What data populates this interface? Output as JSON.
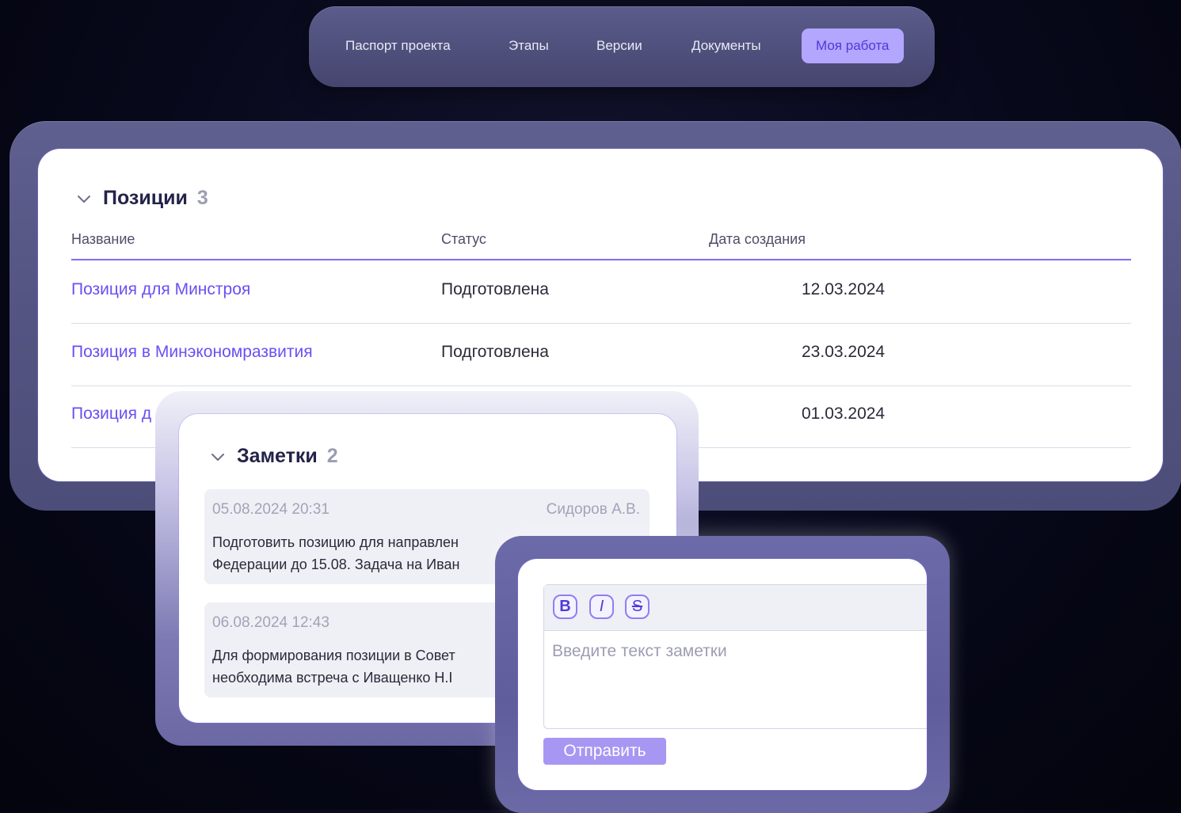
{
  "nav": {
    "items": [
      {
        "label": "Паспорт проекта"
      },
      {
        "label": "Этапы"
      },
      {
        "label": "Версии"
      },
      {
        "label": "Документы"
      },
      {
        "label": "Моя работа",
        "active": true
      }
    ]
  },
  "positions": {
    "title": "Позиции",
    "count": "3",
    "columns": [
      "Название",
      "Статус",
      "Дата создания"
    ],
    "rows": [
      {
        "name": "Позиция для Минстроя",
        "status": "Подготовлена",
        "date": "12.03.2024"
      },
      {
        "name": "Позиция в Минэкономразвития",
        "status": "Подготовлена",
        "date": "23.03.2024"
      },
      {
        "name": "Позиция д",
        "status": "",
        "date": "01.03.2024"
      }
    ]
  },
  "notes": {
    "title": "Заметки",
    "count": "2",
    "items": [
      {
        "date": "05.08.2024 20:31",
        "author": "Сидоров А.В.",
        "line1": "Подготовить позицию для направлен",
        "line2": "Федерации до 15.08. Задача на Иван"
      },
      {
        "date": "06.08.2024 12:43",
        "author": "",
        "line1": "Для формирования позиции в Совет",
        "line2": "необходима встреча с Иващенко Н.I"
      }
    ]
  },
  "editor": {
    "bold": "B",
    "italic": "I",
    "strike": "S",
    "placeholder": "Введите текст заметки",
    "send_label": "Отправить"
  },
  "colors": {
    "accent": "#7f6cf4",
    "link": "#6a4ff3",
    "active_tab_bg": "#b2a6ff",
    "send_button": "#a797f3"
  }
}
